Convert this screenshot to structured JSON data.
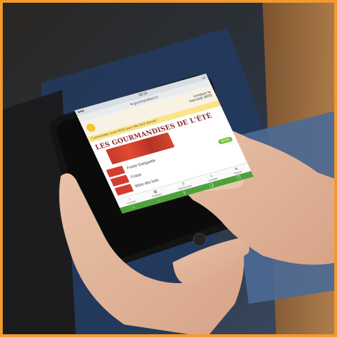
{
  "status_bar": {
    "time": "18:15"
  },
  "url_bar": {
    "url": "gourmandises.fr"
  },
  "header": {
    "date_label": "Livraison le",
    "date": "mercredi 28/05"
  },
  "promo": {
    "text": "Commandez avant 9h00 pour être livré demain !"
  },
  "hero": {
    "title": "LES GOURMANDISES DE L'ÉTÉ"
  },
  "products": [
    {
      "name": "Fraise Gariguette",
      "button": "Ajouter"
    },
    {
      "name": "Fraise",
      "button": ""
    },
    {
      "name": "Mûre des bois",
      "button": ""
    }
  ],
  "bottom_nav": [
    {
      "icon": "home-icon",
      "glyph": "⌂",
      "label": "Accueil"
    },
    {
      "icon": "grid-icon",
      "glyph": "▦",
      "label": "Produits"
    },
    {
      "icon": "search-icon",
      "glyph": "⚲",
      "label": "Rechercher"
    },
    {
      "icon": "user-icon",
      "glyph": "☺",
      "label": "Compte"
    },
    {
      "icon": "cart-icon",
      "glyph": "⊕",
      "label": "Panier"
    }
  ],
  "browser_nav": [
    "‹",
    "›",
    "⇪",
    "❏",
    "❐"
  ],
  "colors": {
    "frame": "#f29a2e",
    "accent_green": "#6fbf3a",
    "title_red": "#8b2a2a"
  }
}
